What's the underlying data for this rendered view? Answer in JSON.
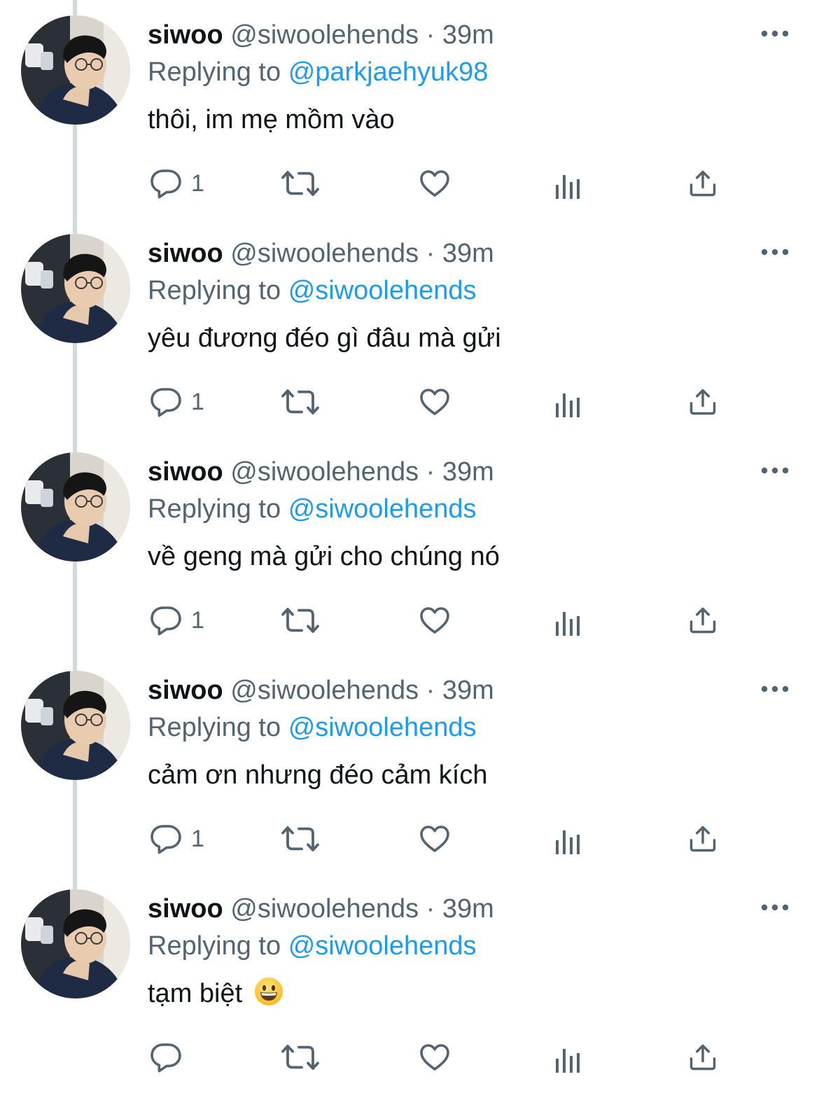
{
  "colors": {
    "text_primary": "#0f1419",
    "text_secondary": "#536471",
    "accent": "#1d9bf0",
    "thread_line": "#cfd9de"
  },
  "tweets": [
    {
      "name": "siwoo",
      "handle": "@siwoolehends",
      "separator": "·",
      "time": "39m",
      "replying_prefix": "Replying to",
      "replying_to": "@parkjaehyuk98",
      "text": "thôi, im mẹ mồm vào",
      "reply_count": "1",
      "icons": [
        "more-icon",
        "reply-icon",
        "retweet-icon",
        "like-icon",
        "views-icon",
        "share-icon"
      ]
    },
    {
      "name": "siwoo",
      "handle": "@siwoolehends",
      "separator": "·",
      "time": "39m",
      "replying_prefix": "Replying to",
      "replying_to": "@siwoolehends",
      "text": "yêu đương đéo gì đâu mà gửi",
      "reply_count": "1",
      "icons": [
        "more-icon",
        "reply-icon",
        "retweet-icon",
        "like-icon",
        "views-icon",
        "share-icon"
      ]
    },
    {
      "name": "siwoo",
      "handle": "@siwoolehends",
      "separator": "·",
      "time": "39m",
      "replying_prefix": "Replying to",
      "replying_to": "@siwoolehends",
      "text": "về geng mà gửi cho chúng nó",
      "reply_count": "1",
      "icons": [
        "more-icon",
        "reply-icon",
        "retweet-icon",
        "like-icon",
        "views-icon",
        "share-icon"
      ]
    },
    {
      "name": "siwoo",
      "handle": "@siwoolehends",
      "separator": "·",
      "time": "39m",
      "replying_prefix": "Replying to",
      "replying_to": "@siwoolehends",
      "text": "cảm ơn nhưng đéo cảm kích",
      "reply_count": "1",
      "icons": [
        "more-icon",
        "reply-icon",
        "retweet-icon",
        "like-icon",
        "views-icon",
        "share-icon"
      ]
    },
    {
      "name": "siwoo",
      "handle": "@siwoolehends",
      "separator": "·",
      "time": "39m",
      "replying_prefix": "Replying to",
      "replying_to": "@siwoolehends",
      "text": "tạm biệt",
      "text_emoji": "grinning-face-emoji",
      "reply_count": "",
      "icons": [
        "more-icon",
        "reply-icon",
        "retweet-icon",
        "like-icon",
        "views-icon",
        "share-icon"
      ]
    }
  ]
}
